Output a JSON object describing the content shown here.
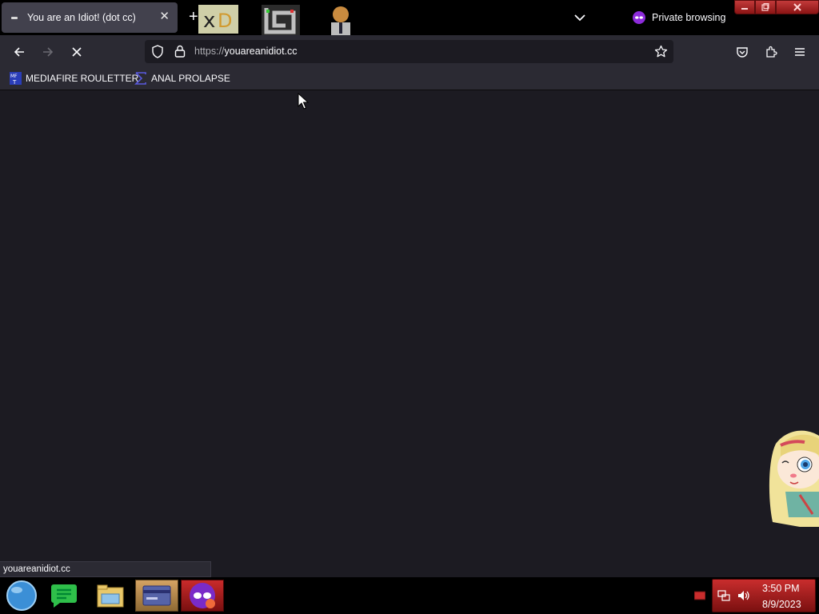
{
  "tabbar": {
    "tab_title": "You are an Idiot! (dot cc)",
    "close_glyph": "✕",
    "newtab_glyph": "+",
    "private_label": "Private browsing"
  },
  "navbar": {
    "url_scheme": "https://",
    "url_host": "youareanidiot.cc",
    "loading": true
  },
  "bookmarks": [
    {
      "label": "MEDIAFIRE ROULETTER",
      "icon": "mediafire-icon"
    },
    {
      "label": "ANAL PROLAPSE",
      "icon": "sigma-icon"
    }
  ],
  "status": {
    "text": "youareanidiot.cc"
  },
  "taskbar": {
    "items": [
      "globe-icon",
      "chat-icon",
      "folder-icon",
      "card-icon",
      "private-browser-icon"
    ],
    "time": "3:50 PM",
    "date": "8/9/2023"
  },
  "colors": {
    "toolbar": "#2b2a33",
    "content": "#1c1b22",
    "tab_active": "#42414d",
    "private_accent": "#8d2bdb",
    "taskbar_red": "#c92d2d"
  }
}
